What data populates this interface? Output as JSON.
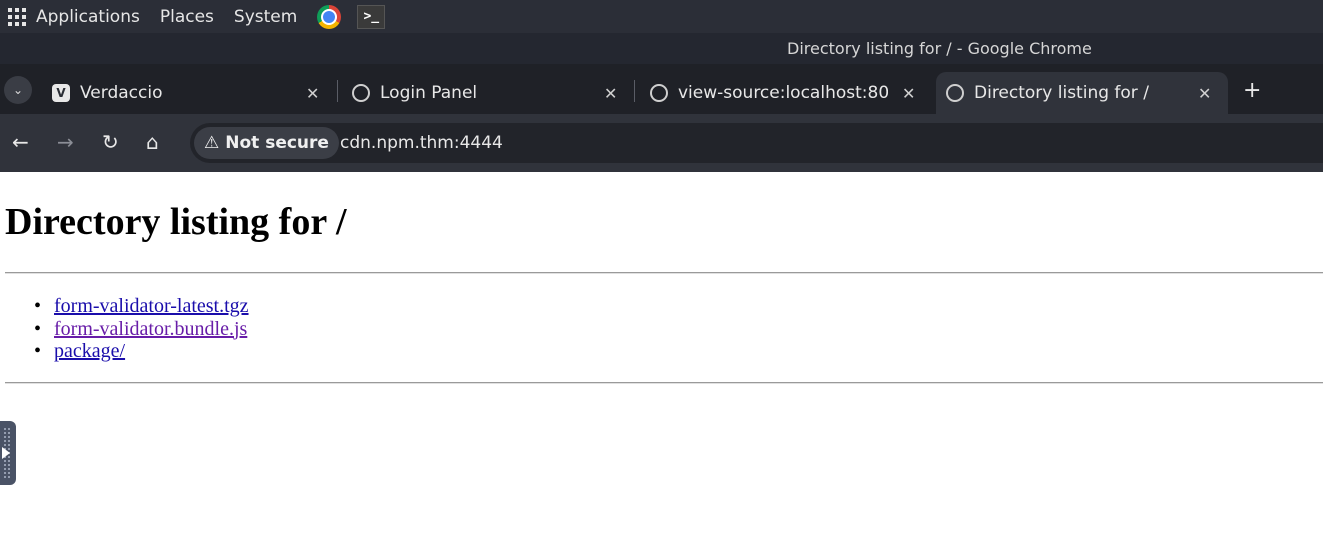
{
  "system_bar": {
    "menus": [
      "Applications",
      "Places",
      "System"
    ],
    "icons": [
      "apps-grid-icon",
      "chrome-icon",
      "terminal-icon"
    ]
  },
  "window": {
    "title": "Directory listing for / - Google Chrome"
  },
  "tabs": [
    {
      "title": "Verdaccio",
      "favicon": "verdaccio-icon",
      "active": false
    },
    {
      "title": "Login Panel",
      "favicon": "globe-icon",
      "active": false
    },
    {
      "title": "view-source:localhost:80",
      "favicon": "globe-icon",
      "active": false
    },
    {
      "title": "Directory listing for /",
      "favicon": "globe-icon",
      "active": true
    }
  ],
  "toolbar": {
    "security_label": "Not secure",
    "url": "cdn.npm.thm:4444"
  },
  "page": {
    "heading": "Directory listing for /",
    "files": [
      {
        "name": "form-validator-latest.tgz",
        "visited": false
      },
      {
        "name": "form-validator.bundle.js",
        "visited": true
      },
      {
        "name": "package/",
        "visited": false
      }
    ]
  },
  "colors": {
    "link": "#1a0dab",
    "visited_link": "#681da8",
    "system_bar_bg": "#2b2e37",
    "tab_strip_bg": "#1f2127"
  }
}
